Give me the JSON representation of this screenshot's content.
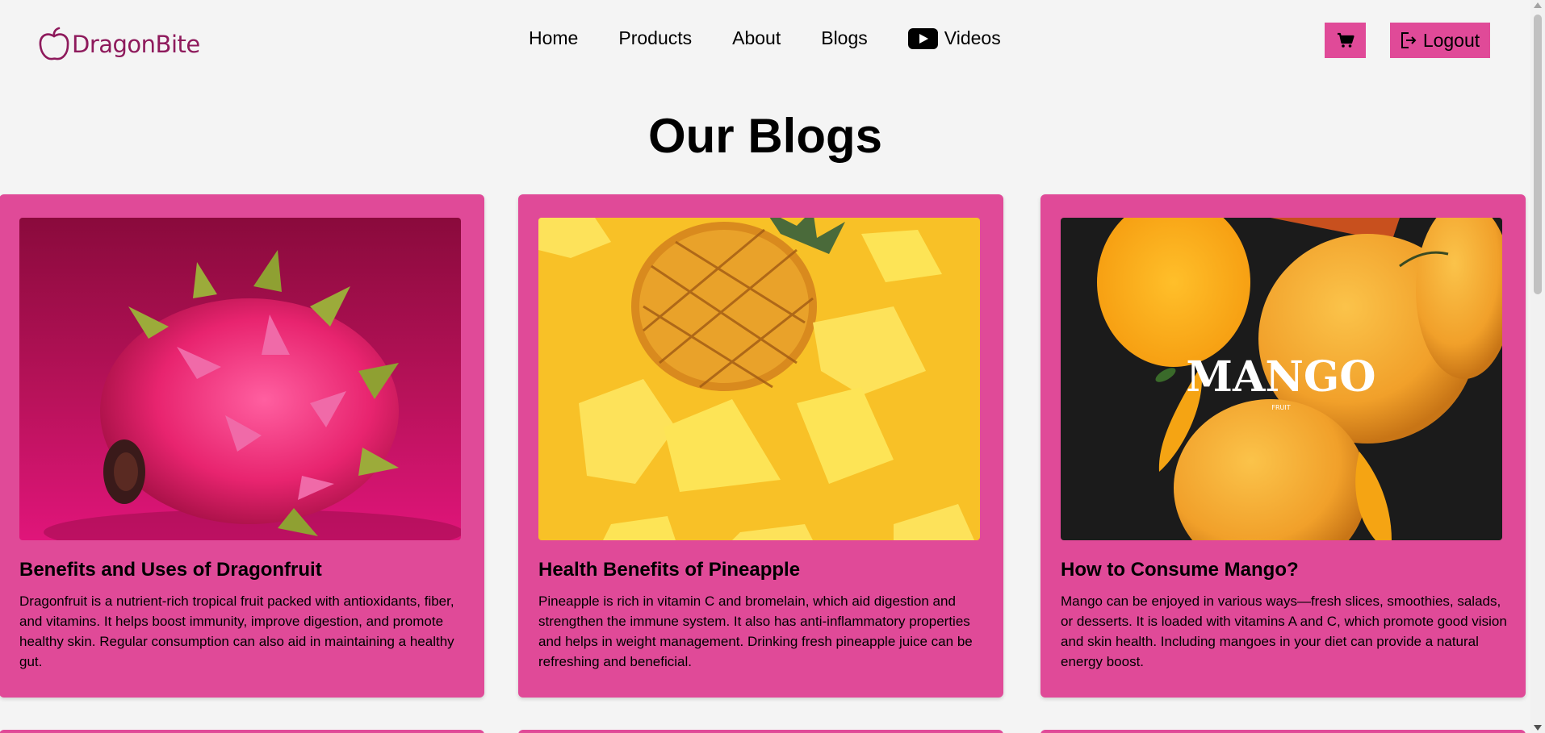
{
  "brand": {
    "name": "DragonBite",
    "color": "#8e1a5c"
  },
  "nav": {
    "home": "Home",
    "products": "Products",
    "about": "About",
    "blogs": "Blogs",
    "videos": "Videos"
  },
  "header": {
    "cart_icon": "cart-icon",
    "logout_label": "Logout"
  },
  "page": {
    "title": "Our Blogs"
  },
  "blogs": [
    {
      "title": "Benefits and Uses of Dragonfruit",
      "description": "Dragonfruit is a nutrient-rich tropical fruit packed with antioxidants, fiber, and vitamins. It helps boost immunity, improve digestion, and promote healthy skin. Regular consumption can also aid in maintaining a healthy gut."
    },
    {
      "title": "Health Benefits of Pineapple",
      "description": "Pineapple is rich in vitamin C and bromelain, which aid digestion and strengthen the immune system. It also has anti-inflammatory properties and helps in weight management. Drinking fresh pineapple juice can be refreshing and beneficial."
    },
    {
      "title": "How to Consume Mango?",
      "description": "Mango can be enjoyed in various ways—fresh slices, smoothies, salads, or desserts. It is loaded with vitamins A and C, which promote good vision and skin health. Including mangoes in your diet can provide a natural energy boost.",
      "image_text": "MANGO",
      "image_subtext": "FRUIT"
    }
  ],
  "colors": {
    "accent": "#e04a98",
    "background": "#f4f4f4"
  }
}
